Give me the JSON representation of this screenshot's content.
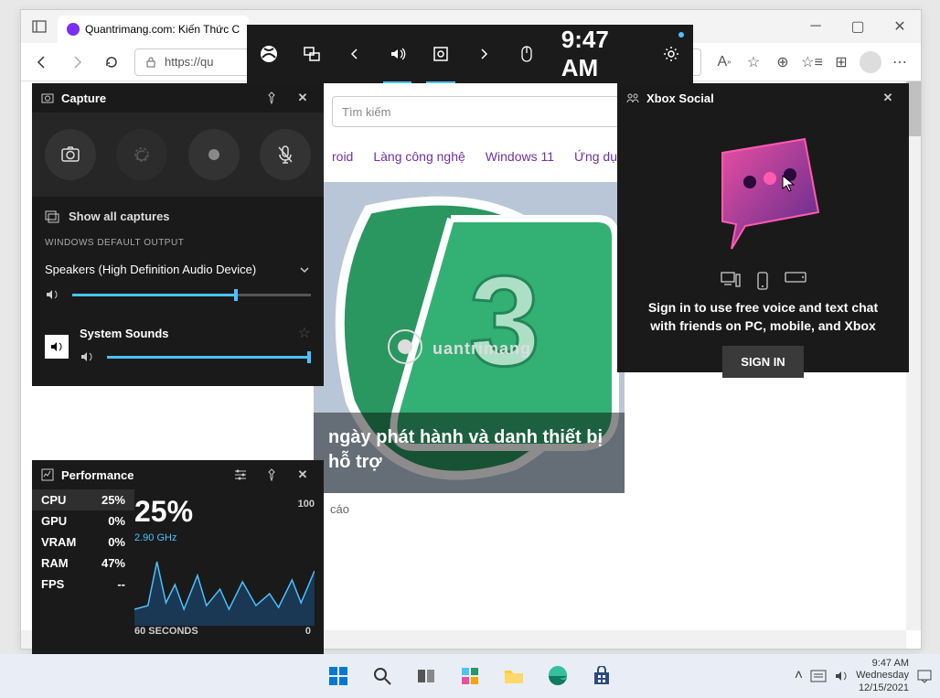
{
  "browser": {
    "tab_title": "Quantrimang.com: Kiến Thức C",
    "url": "https://qu",
    "search_placeholder": "Tìm kiếm",
    "nav": [
      "roid",
      "Làng công nghệ",
      "Windows 11",
      "Ứng dụn"
    ],
    "hero_caption": "ngày phát hành và danh    thiết bị hỗ trợ",
    "below": "cáo"
  },
  "gamebar": {
    "time": "9:47 AM"
  },
  "capture": {
    "title": "Capture",
    "show_all": "Show all captures",
    "section_label": "WINDOWS DEFAULT OUTPUT",
    "device": "Speakers (High Definition Audio Device)",
    "system_sounds": "System Sounds",
    "speaker_vol": 68,
    "system_vol": 100
  },
  "performance": {
    "title": "Performance",
    "stats": [
      {
        "label": "CPU",
        "value": "25%"
      },
      {
        "label": "GPU",
        "value": "0%"
      },
      {
        "label": "VRAM",
        "value": "0%"
      },
      {
        "label": "RAM",
        "value": "47%"
      },
      {
        "label": "FPS",
        "value": "--"
      }
    ],
    "big": "25%",
    "max": "100",
    "ghz": "2.90 GHz",
    "xlabel": "60 SECONDS",
    "zero": "0"
  },
  "social": {
    "title": "Xbox Social",
    "text": "Sign in to use free voice and text chat with friends on PC, mobile, and Xbox",
    "button": "SIGN IN"
  },
  "taskbar": {
    "time": "9:47 AM",
    "day": "Wednesday",
    "date": "12/15/2021"
  },
  "chart_data": {
    "type": "line",
    "title": "CPU usage",
    "xlabel": "60 SECONDS",
    "ylabel": "%",
    "ylim": [
      0,
      100
    ],
    "x": [
      0,
      5,
      10,
      15,
      20,
      25,
      30,
      35,
      40,
      45,
      50,
      55,
      60
    ],
    "values": [
      20,
      25,
      70,
      30,
      45,
      20,
      55,
      25,
      40,
      22,
      48,
      30,
      60
    ],
    "current": 25,
    "ghz": 2.9
  }
}
